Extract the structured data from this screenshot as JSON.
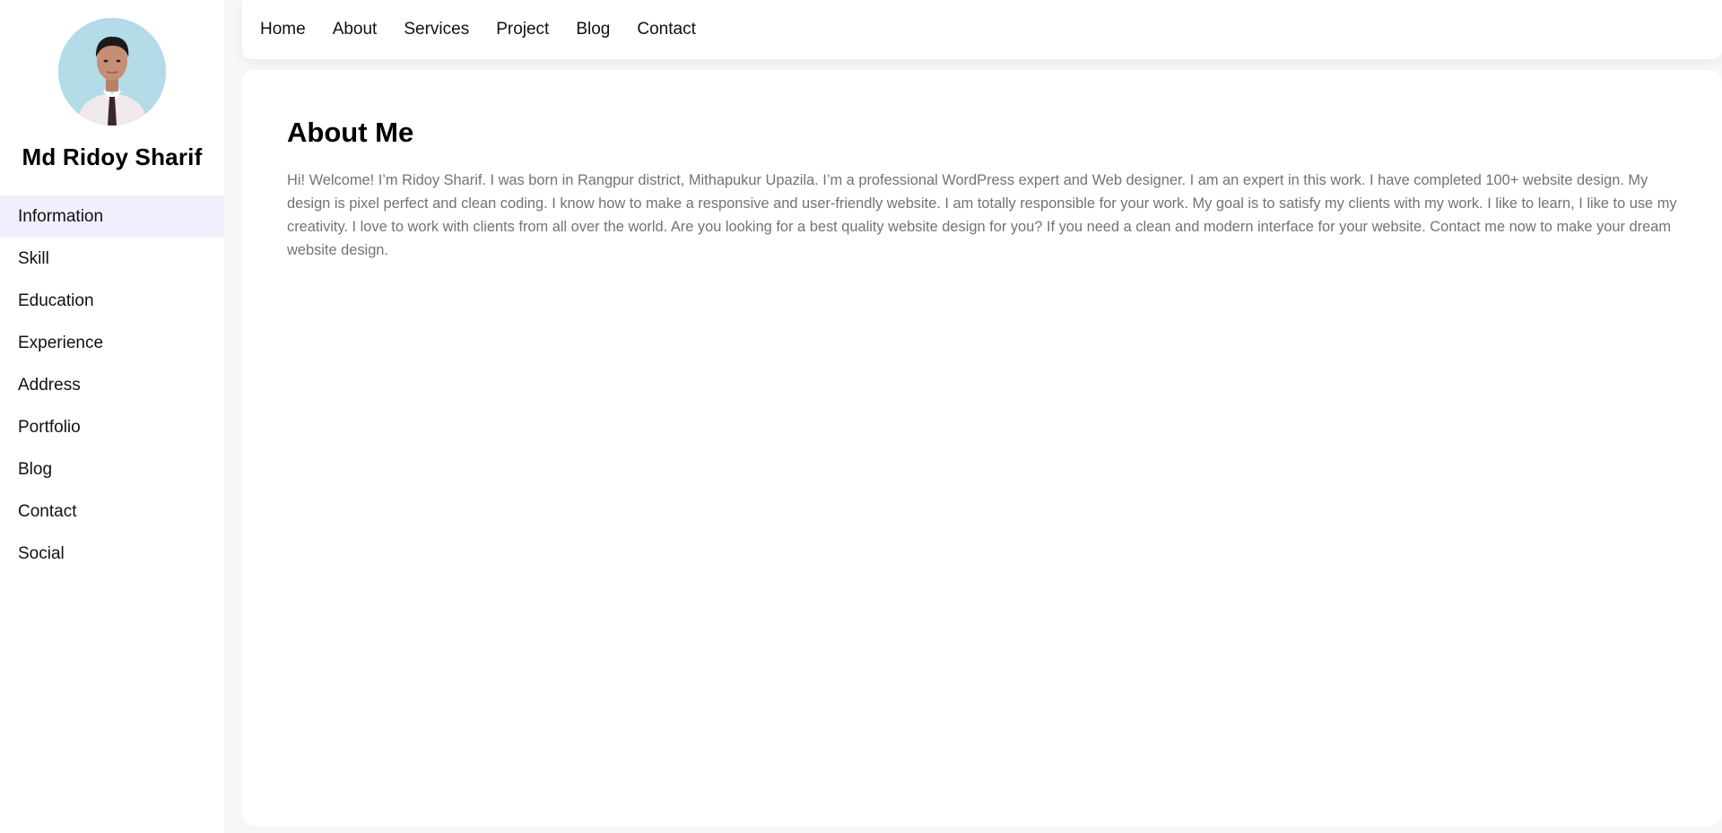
{
  "profile": {
    "name": "Md Ridoy Sharif"
  },
  "sidebar": {
    "items": [
      {
        "label": "Information",
        "active": true
      },
      {
        "label": "Skill",
        "active": false
      },
      {
        "label": "Education",
        "active": false
      },
      {
        "label": "Experience",
        "active": false
      },
      {
        "label": "Address",
        "active": false
      },
      {
        "label": "Portfolio",
        "active": false
      },
      {
        "label": "Blog",
        "active": false
      },
      {
        "label": "Contact",
        "active": false
      },
      {
        "label": "Social",
        "active": false
      }
    ]
  },
  "topnav": {
    "items": [
      "Home",
      "About",
      "Services",
      "Project",
      "Blog",
      "Contact"
    ]
  },
  "main": {
    "title": "About Me",
    "body": "Hi! Welcome! I’m Ridoy Sharif. I was born in Rangpur district, Mithapukur Upazila. I’m a professional WordPress expert and Web designer. I am an expert in this work. I have completed 100+ website design. My design is pixel perfect and clean coding. I know how to make a responsive and user-friendly website. I am totally responsible for your work. My goal is to satisfy my clients with my work. I like to learn, I like to use my creativity. I love to work with clients from all over the world. Are you looking for a best quality website design for you? If you need a clean and modern interface for your website. Contact me now to make your dream website design."
  },
  "colors": {
    "active_background": "#f1effd",
    "avatar_background": "#b3dbe8",
    "body_text": "#737373",
    "page_background": "#f7f7f8"
  }
}
